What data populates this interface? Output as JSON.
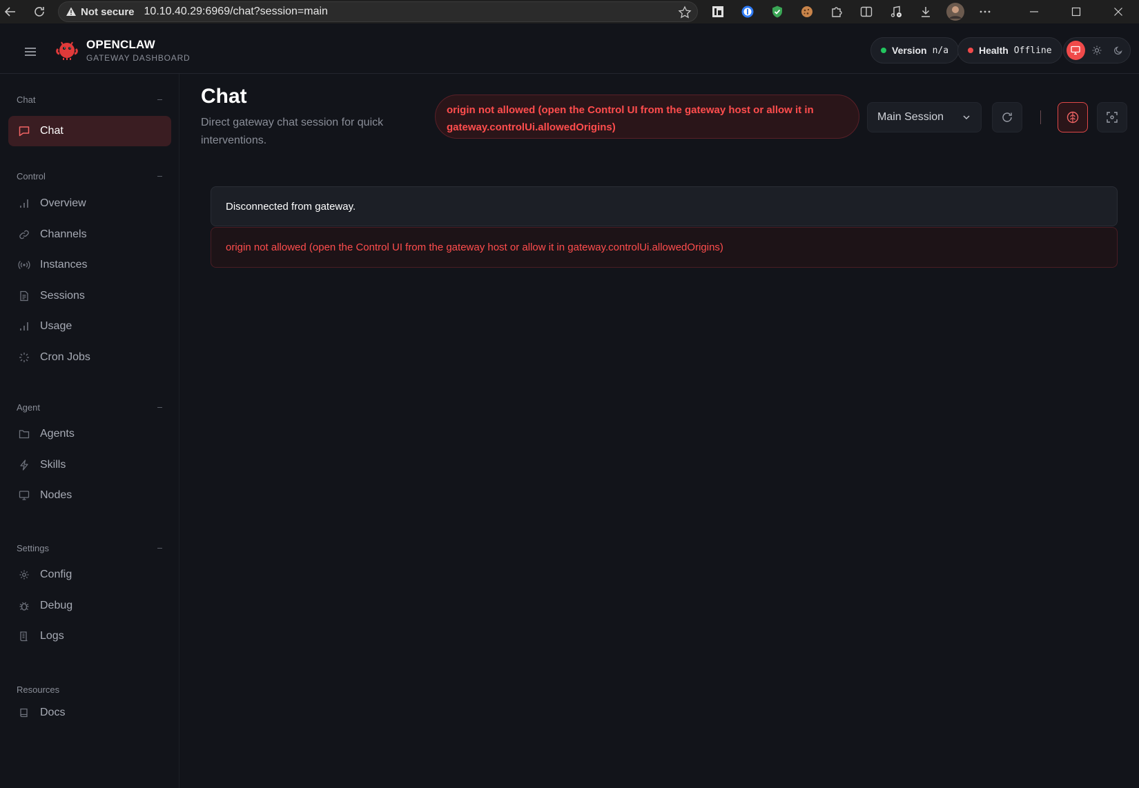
{
  "browser": {
    "security_label": "Not secure",
    "url": "10.10.40.29:6969/chat?session=main"
  },
  "header": {
    "brand_title": "OPENCLAW",
    "brand_subtitle": "GATEWAY DASHBOARD",
    "version_label": "Version",
    "version_value": "n/a",
    "health_label": "Health",
    "health_value": "Offline"
  },
  "colors": {
    "accent": "#f04a4a",
    "ok": "#22c55e",
    "error_text": "#ff4d4d"
  },
  "sidebar": {
    "sections": [
      {
        "label": "Chat",
        "items": [
          {
            "label": "Chat",
            "icon": "chat-bubble-icon",
            "active": true
          }
        ]
      },
      {
        "label": "Control",
        "items": [
          {
            "label": "Overview",
            "icon": "bar-chart-icon"
          },
          {
            "label": "Channels",
            "icon": "link-icon"
          },
          {
            "label": "Instances",
            "icon": "radio-signal-icon"
          },
          {
            "label": "Sessions",
            "icon": "document-icon"
          },
          {
            "label": "Usage",
            "icon": "bar-chart-icon"
          },
          {
            "label": "Cron Jobs",
            "icon": "loader-icon"
          }
        ]
      },
      {
        "label": "Agent",
        "items": [
          {
            "label": "Agents",
            "icon": "folder-icon"
          },
          {
            "label": "Skills",
            "icon": "lightning-icon"
          },
          {
            "label": "Nodes",
            "icon": "monitor-icon"
          }
        ]
      },
      {
        "label": "Settings",
        "items": [
          {
            "label": "Config",
            "icon": "gear-icon"
          },
          {
            "label": "Debug",
            "icon": "bug-icon"
          },
          {
            "label": "Logs",
            "icon": "scroll-icon"
          }
        ]
      },
      {
        "label": "Resources",
        "items": [
          {
            "label": "Docs",
            "icon": "book-icon"
          }
        ]
      }
    ]
  },
  "main": {
    "title": "Chat",
    "subtitle": "Direct gateway chat session for quick interventions.",
    "error_banner": "origin not allowed (open the Control UI from the gateway host or allow it in gateway.controlUi.allowedOrigins)",
    "session_select": "Main Session",
    "messages": {
      "info": "Disconnected from gateway.",
      "error": "origin not allowed (open the Control UI from the gateway host or allow it in gateway.controlUi.allowedOrigins)"
    }
  }
}
